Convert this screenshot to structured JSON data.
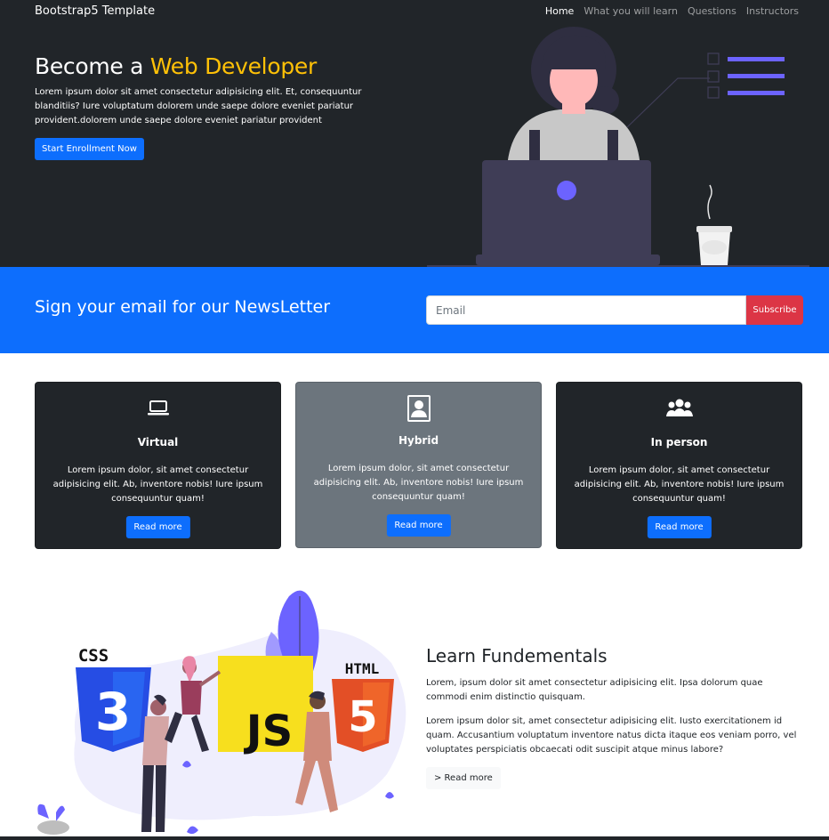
{
  "navbar": {
    "brand": "Bootstrap5 Template",
    "links": [
      "Home",
      "What you will learn",
      "Questions",
      "Instructors"
    ]
  },
  "hero": {
    "title_prefix": "Become a ",
    "title_accent": "Web Developer",
    "description": "Lorem ipsum dolor sit amet consectetur adipisicing elit. Et, consequuntur blanditiis? Iure voluptatum dolorem unde saepe dolore eveniet pariatur provident.dolorem unde saepe dolore eveniet pariatur provident",
    "cta_label": "Start Enrollment Now"
  },
  "newsletter": {
    "heading": "Sign your email for our NewsLetter",
    "email_placeholder": "Email",
    "subscribe_label": "Subscribe"
  },
  "cards": [
    {
      "icon": "laptop-icon",
      "title": "Virtual",
      "text": "Lorem ipsum dolor, sit amet consectetur adipisicing elit. Ab, inventore nobis! Iure ipsum consequuntur quam!",
      "button": "Read more"
    },
    {
      "icon": "person-badge-icon",
      "title": "Hybrid",
      "text": "Lorem ipsum dolor, sit amet consectetur adipisicing elit. Ab, inventore nobis! Iure ipsum consequuntur quam!",
      "button": "Read more"
    },
    {
      "icon": "people-icon",
      "title": "In person",
      "text": "Lorem ipsum dolor, sit amet consectetur adipisicing elit. Ab, inventore nobis! Iure ipsum consequuntur quam!",
      "button": "Read more"
    }
  ],
  "learn": {
    "title": "Learn Fundementals",
    "paragraph1": "Lorem, ipsum dolor sit amet consectetur adipisicing elit. Ipsa dolorum quae commodi enim distinctio quisquam.",
    "paragraph2": "Lorem ipsum dolor sit, amet consectetur adipisicing elit. Iusto exercitationem id quam. Accusantium voluptatum inventore natus dicta itaque eos veniam porro, vel voluptates perspiciatis obcaecati odit suscipit atque minus labore?",
    "button": "> Read more",
    "illustration_labels": {
      "css": "CSS",
      "js": "JS",
      "html": "HTML"
    }
  },
  "colors": {
    "dark": "#212529",
    "primary": "#0d6efd",
    "accent": "#ffc107",
    "danger": "#dc3545",
    "secondary": "#6c757d",
    "illustration_purple": "#6c63ff"
  }
}
